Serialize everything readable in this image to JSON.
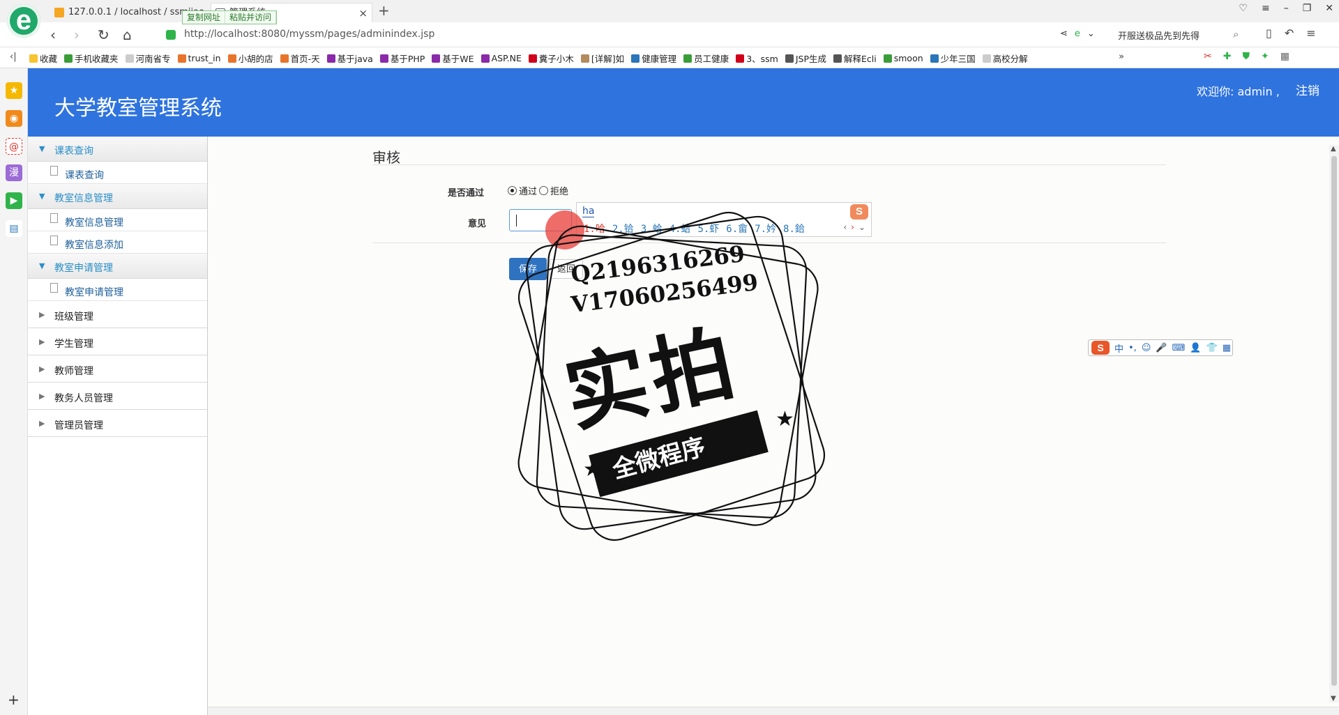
{
  "browser": {
    "logo_glyph": "e",
    "tabs": [
      {
        "label": "127.0.0.1 / localhost / ssmjiao"
      },
      {
        "label": "管理系统"
      }
    ],
    "url_tooltip": {
      "copy": "复制网址",
      "paste": "粘贴并访问"
    },
    "address": "http://localhost:8080/myssm/pages/adminindex.jsp",
    "search_hint": "开服送极品先到先得",
    "bookmarks": [
      "收藏",
      "手机收藏夹",
      "河南省专",
      "trust_in",
      "小胡的店",
      "首页-天",
      "基于java",
      "基于PHP",
      "基于WE",
      "ASP.NE",
      "糞子小木",
      "[详解]如",
      "健康管理",
      "员工健康",
      "3、ssm",
      "JSP生成",
      "解释Ecli",
      "smoon",
      "少年三国",
      "高校分解"
    ],
    "bookmarks_more": "»"
  },
  "app": {
    "title": "大学教室管理系统",
    "welcome": "欢迎你: admin ,",
    "logout": "注销"
  },
  "sidebar": {
    "groups": [
      {
        "label": "课表查询",
        "open": true,
        "items": [
          "课表查询"
        ]
      },
      {
        "label": "教室信息管理",
        "open": true,
        "items": [
          "教室信息管理",
          "教室信息添加"
        ]
      },
      {
        "label": "教室申请管理",
        "open": true,
        "items": [
          "教室申请管理"
        ]
      },
      {
        "label": "班级管理",
        "open": false
      },
      {
        "label": "学生管理",
        "open": false
      },
      {
        "label": "教师管理",
        "open": false
      },
      {
        "label": "教务人员管理",
        "open": false
      },
      {
        "label": "管理员管理",
        "open": false
      }
    ]
  },
  "form": {
    "title": "审核",
    "pass_label": "是否通过",
    "options": [
      {
        "label": "通过",
        "checked": true
      },
      {
        "label": "拒绝",
        "checked": false
      }
    ],
    "opinion_label": "意见",
    "opinion_value": "",
    "save_label": "保存",
    "back_label": "返回"
  },
  "ime": {
    "pinyin": "ha",
    "candidates": [
      "1.哈",
      "2.铪",
      "3.蛤",
      "4.蛤",
      "5.虾",
      "6.畲",
      "7.妗",
      "8.鉿"
    ],
    "logo": "S",
    "toolbar": {
      "logo": "S",
      "mode": "中",
      "punct": "•,",
      "icons": [
        "☺",
        "🎤",
        "⌨",
        "👤",
        "👕",
        "▦"
      ]
    }
  },
  "watermark": {
    "line1": "Q2196316269",
    "line2": "V17060256499",
    "big": "实拍",
    "small": "全微程序"
  },
  "colors": {
    "header": "#2f73de",
    "sidebar_accent": "#2a8fc7",
    "save_button": "#2f73c0"
  }
}
